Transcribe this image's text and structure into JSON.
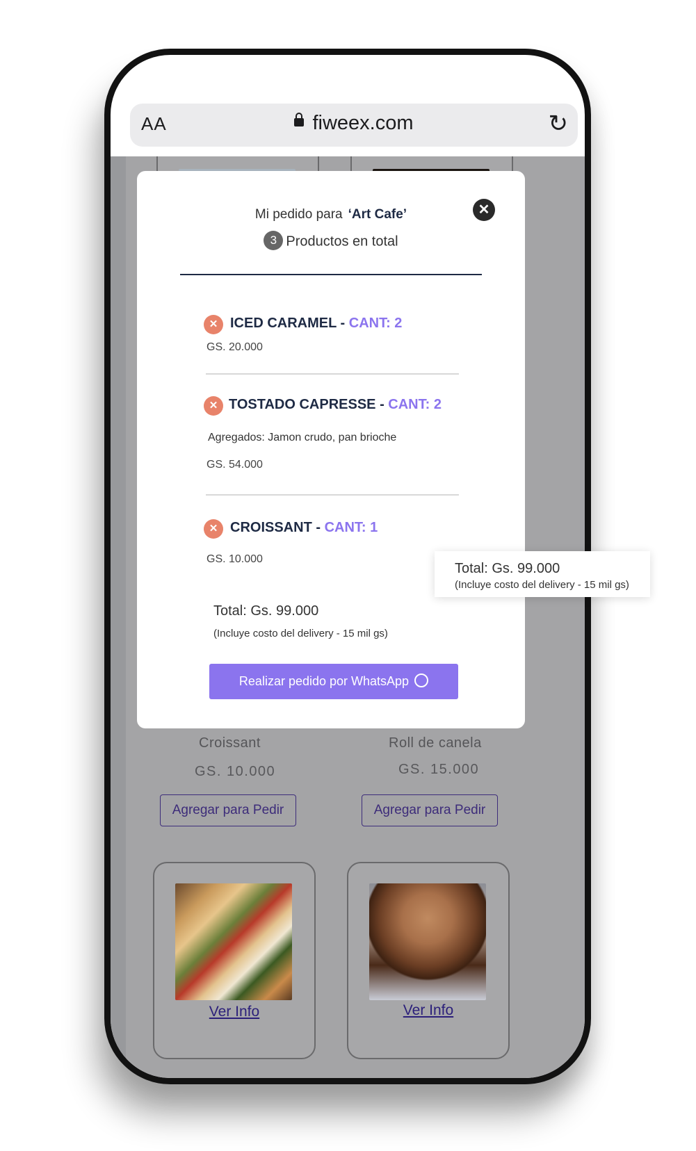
{
  "browser": {
    "text_size_label": "AA",
    "url": "fiweex.com",
    "reload_icon": "reload-icon",
    "lock_icon": "lock-icon"
  },
  "background_products": [
    {
      "name": "Croissant",
      "price": "GS. 10.000",
      "add_label": "Agregar para Pedir"
    },
    {
      "name": "Roll de canela",
      "price": "GS. 15.000",
      "add_label": "Agregar para Pedir"
    }
  ],
  "bottom_cards": [
    {
      "image": "panini-photo",
      "link": "Ver Info"
    },
    {
      "image": "cupcake-photo",
      "link": "Ver Info"
    }
  ],
  "modal": {
    "title_prefix": "Mi pedido para",
    "shop_name": "‘Art Cafe’",
    "count": "3",
    "subtitle": "Productos en total",
    "close_icon": "close-icon",
    "items": [
      {
        "name": "ICED CARAMEL -",
        "qty": "CANT: 2",
        "extras": "",
        "price": "GS. 20.000"
      },
      {
        "name": "TOSTADO CAPRESSE -",
        "qty": "CANT: 2",
        "extras": "Agregados: Jamon crudo, pan brioche",
        "price": "GS. 54.000"
      },
      {
        "name": "CROISSANT -",
        "qty": "CANT: 1",
        "extras": "",
        "price": "GS. 10.000"
      }
    ],
    "total": "Total: Gs. 99.000",
    "total_note": "(Incluye costo del delivery - 15 mil gs)",
    "whatsapp_button": "Realizar pedido por WhatsApp",
    "whatsapp_icon": "whatsapp-icon"
  },
  "callout": {
    "total": "Total: Gs. 99.000",
    "note": "(Incluye costo del delivery - 15 mil gs)"
  },
  "colors": {
    "accent": "#8b74ee",
    "remove": "#e8836a",
    "dark_text": "#1e2a44",
    "overlay": "#a4a4a6"
  }
}
